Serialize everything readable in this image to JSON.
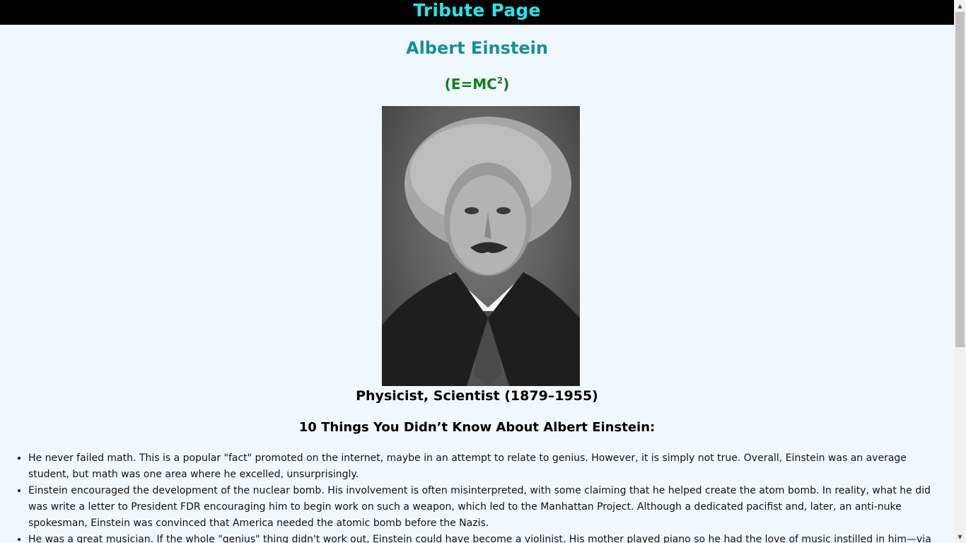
{
  "header": {
    "title": "Tribute Page"
  },
  "main": {
    "title": "Albert Einstein",
    "formula_base": "(E=MC",
    "formula_exp": "2",
    "formula_close": ")",
    "image_caption": "Physicist, Scientist (1879–1955)",
    "facts_heading": "10 Things You Didn’t Know About Albert Einstein:",
    "facts": [
      "He never failed math. This is a popular \"fact\" promoted on the internet, maybe in an attempt to relate to genius. However, it is simply not true. Overall, Einstein was an average student, but math was one area where he excelled, unsurprisingly.",
      "Einstein encouraged the development of the nuclear bomb. His involvement is often misinterpreted, with some claiming that he helped create the atom bomb. In reality, what he did was write a letter to President FDR encouraging him to begin work on such a weapon, which led to the Manhattan Project. Although a dedicated pacifist and, later, an anti-nuke spokesman, Einstein was convinced that America needed the atomic bomb before the Nazis.",
      "He was a great musician. If the whole \"genius\" thing didn't work out, Einstein could have become a violinist. His mother played piano so he had the love of music instilled in him—via violin lessons—at"
    ]
  },
  "colors": {
    "header_bg": "#000000",
    "header_text": "#22e8ee",
    "title": "#139196",
    "formula": "#128012",
    "page_bg": "#f0f8ff"
  },
  "icons": [
    "portrait-image",
    "bullet-icon",
    "scroll-up-arrow-icon",
    "scroll-down-arrow-icon"
  ]
}
